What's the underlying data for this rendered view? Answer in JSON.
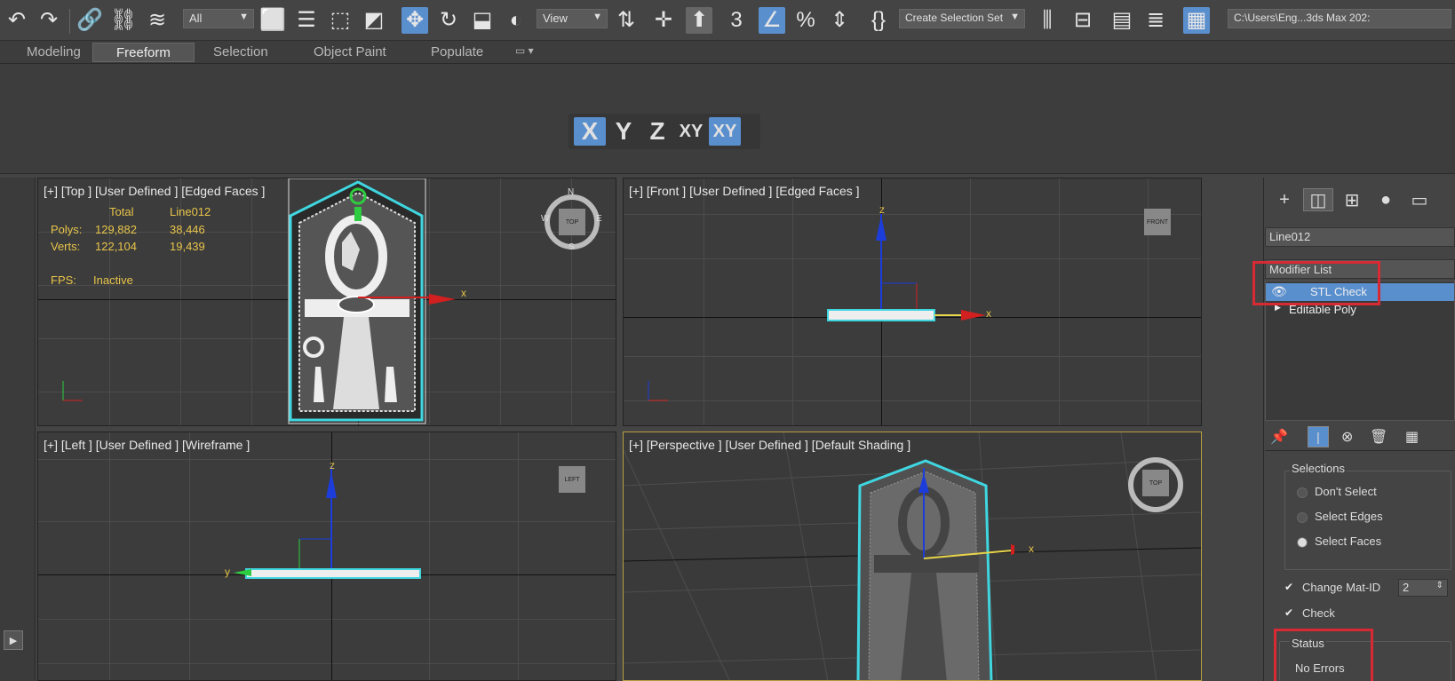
{
  "toolbar": {
    "selection_filter": "All",
    "ref_coord": "View",
    "named_selection": "Create Selection Set",
    "path": "C:\\Users\\Eng...3ds Max 202:",
    "icons": [
      "undo-icon",
      "redo-icon",
      "link-icon",
      "unlink-icon",
      "bind-space-warp-icon",
      "select-object-icon",
      "select-by-name-icon",
      "rect-selection-icon",
      "window-crossing-icon",
      "move-icon",
      "rotate-icon",
      "scale-icon",
      "select-place-icon",
      "pivot-icon",
      "keyboard-shortcut-icon",
      "snap-3d-icon",
      "angle-snap-icon",
      "percent-snap-icon",
      "spinner-snap-icon",
      "edit-named-selection-icon",
      "mirror-icon",
      "align-icon",
      "scene-explorer-icon",
      "layer-explorer-icon",
      "toggle-ribbon-icon"
    ]
  },
  "ribbon": {
    "tabs": [
      "Modeling",
      "Freeform",
      "Selection",
      "Object Paint",
      "Populate"
    ],
    "active_tab": "Freeform",
    "axis_buttons": [
      "X",
      "Y",
      "Z",
      "XY",
      "XY"
    ]
  },
  "viewports": {
    "top": {
      "label": "[+] [Top ] [User Defined ] [Edged Faces ]",
      "stats": {
        "total_header": "Total",
        "object_header": "Line012",
        "polys_label": "Polys:",
        "polys_total": "129,882",
        "polys_object": "38,446",
        "verts_label": "Verts:",
        "verts_total": "122,104",
        "verts_object": "19,439",
        "fps_label": "FPS:",
        "fps_value": "Inactive"
      },
      "viewcube": "TOP",
      "compass": {
        "n": "N",
        "s": "S",
        "e": "E",
        "w": "W"
      }
    },
    "front": {
      "label": "[+] [Front ] [User Defined ] [Edged Faces ]",
      "viewcube": "FRONT"
    },
    "left": {
      "label": "[+] [Left ] [User Defined ] [Wireframe ]",
      "viewcube": "LEFT"
    },
    "perspective": {
      "label": "[+] [Perspective ] [User Defined ] [Default Shading ]",
      "viewcube": "TOP"
    }
  },
  "axes": {
    "x": "x",
    "y": "y",
    "z": "z"
  },
  "command_panel": {
    "object_name": "Line012",
    "modifier_list": "Modifier List",
    "stack": [
      "STL Check",
      "Editable Poly"
    ],
    "selections_title": "Selections",
    "options": [
      "Don't Select",
      "Select Edges",
      "Select Faces"
    ],
    "change_mat_id_label": "Change Mat-ID",
    "change_mat_id_value": "2",
    "check_label": "Check",
    "status_title": "Status",
    "status_value": "No Errors"
  },
  "colors": {
    "accent": "#5a8fce",
    "highlight_box": "#d72a35",
    "stats_text": "#e8c44a",
    "selection_cyan": "#3fd6e0"
  }
}
